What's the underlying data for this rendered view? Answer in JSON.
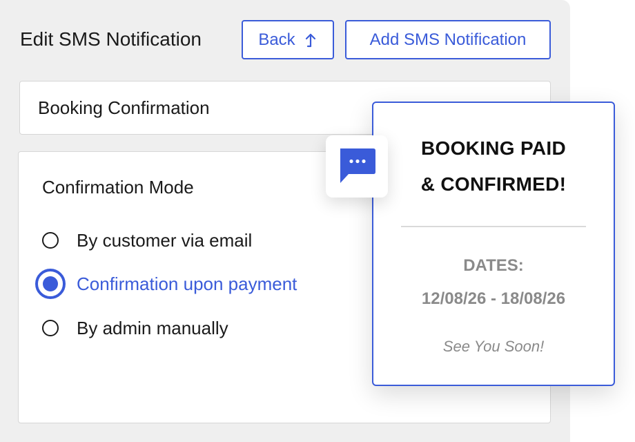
{
  "header": {
    "title": "Edit SMS Notification",
    "back_label": "Back",
    "add_label": "Add SMS Notification"
  },
  "name_field": {
    "value": "Booking Confirmation"
  },
  "confirmation": {
    "title": "Confirmation Mode",
    "options": [
      {
        "label": "By customer via email",
        "selected": false
      },
      {
        "label": "Confirmation upon payment",
        "selected": true
      },
      {
        "label": "By admin manually",
        "selected": false
      }
    ]
  },
  "sms_preview": {
    "icon": "chat-bubble-icon",
    "heading_line1": "BOOKING PAID",
    "heading_line2": "& CONFIRMED!",
    "dates_label": "DATES:",
    "dates_value": "12/08/26 - 18/08/26",
    "signoff": "See You Soon!"
  },
  "colors": {
    "accent": "#3a5bd9",
    "panel_bg": "#efefef",
    "muted_text": "#8a8a8a"
  }
}
